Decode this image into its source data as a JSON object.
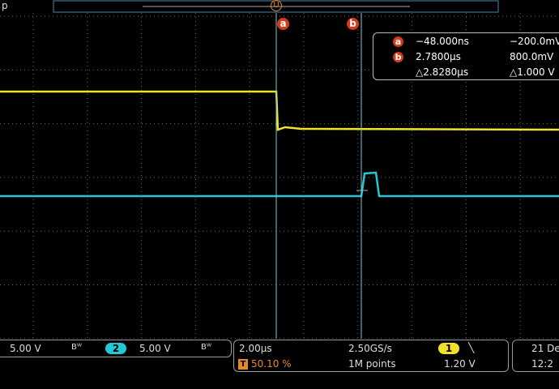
{
  "header": {
    "left_label": "p",
    "trigger_marker": "U"
  },
  "cursors": {
    "a_label": "a",
    "b_label": "b"
  },
  "readout": {
    "a": {
      "badge": "a",
      "time": "−48.000ns",
      "volt": "−200.0mV"
    },
    "b": {
      "badge": "b",
      "time": "2.7800μs",
      "volt": "800.0mV"
    },
    "delta": {
      "time": "△2.8280μs",
      "volt": "△1.000 V"
    }
  },
  "status": {
    "ch1_scale": "5.00 V",
    "ch1_bw": "Bᵂ",
    "ch2_badge": "2",
    "ch2_scale": "5.00 V",
    "ch2_bw": "Bᵂ",
    "timebase": "2.00μs",
    "trigger_badge": "T",
    "trigger_pos": "50.10 %",
    "sample_rate": "2.50GS/s",
    "record_length": "1M points",
    "trig_source_badge": "1",
    "trig_slope": "╲",
    "trig_level": "1.20 V",
    "date": "21 De",
    "time": "12:2"
  },
  "colors": {
    "ch1": "#f0e12b",
    "ch2": "#22c8d6",
    "cursor": "#d53a1b",
    "trigger": "#e38b2a",
    "grid": "#6a6a6a"
  },
  "waveforms": {
    "ch1": {
      "high_level": 1.2,
      "low_level": 0.4,
      "edge_time_us": -0.048
    },
    "ch2": {
      "base_level": 0.0,
      "pulse_level": 0.8,
      "pulse_start_us": 2.78,
      "pulse_end_us": 3.2
    }
  }
}
